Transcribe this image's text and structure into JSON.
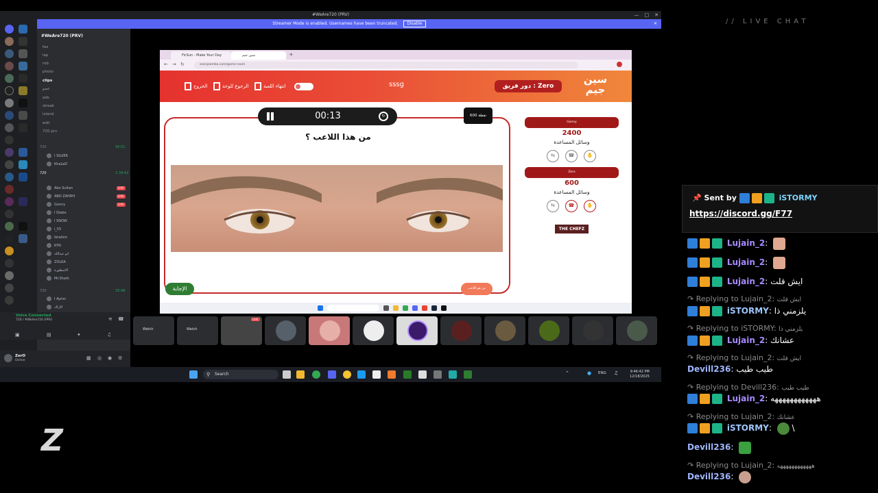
{
  "discord": {
    "window_title": "#WeAre720 (PRV)",
    "streamer_notice": "Streamer Mode is enabled. Usernames have been truncated.",
    "disable_label": "Disable",
    "close_glyph": "✕",
    "server_name": "#WeAre720 (PRV)",
    "channels": [
      "fax",
      "lap",
      "rob",
      "photo",
      "clips",
      "عضو",
      "ads",
      "streak",
      "island",
      "edit",
      "720 prv"
    ],
    "category_1": "720",
    "category_1_time": "56:51",
    "voice_1_users": [
      "I SILVER",
      "KhaLeD"
    ],
    "voice_2_name": "720",
    "voice_2_time": "1:34:42",
    "voice_2_users": [
      "Abo Sultan",
      "ABO ZAHRH",
      "Gonny",
      "I Diabo",
      "I SNOW",
      "i_55",
      "Ibrahim",
      "KYN",
      "ابو عبدالله",
      "ZOLKA",
      "الاسطورة",
      "Mr.Shark"
    ],
    "live_label": "LIVE",
    "category_3": "720",
    "category_3_time": "33:48",
    "voice_3_users": [
      "I Aymn",
      "الاراك"
    ],
    "voice_connected": "Voice Connected",
    "voice_channel": "720 / #WeAre720 (PRV)",
    "user_name": "ZerO",
    "user_tag": "Online"
  },
  "browser": {
    "tab_1": "FicSun - Make Your Day",
    "tab_2": "سين جيم",
    "url": "seenjeemba.com/game-room"
  },
  "game": {
    "center_title": "sssg",
    "turn_label": "دور فريق : Zero",
    "logo_text": "سين جيم",
    "btn_exit": "الخروج",
    "btn_back_board": "الرجوع للوحة",
    "btn_end_game": "انتهاء اللعبة",
    "timer": "00:13",
    "points_tag": "600 نقطة",
    "question": "من هذا اللاعب ؟",
    "answer_btn": "الإجابة",
    "who_btn": "من هو اللاعب",
    "team_1_name": "Gonny",
    "team_1_score": "2400",
    "team_1_help": "وسائل المساعدة",
    "team_2_name": "Zero",
    "team_2_score": "600",
    "team_2_help": "وسائل المساعدة",
    "sponsor": "THE CHEFZ"
  },
  "tiles": {
    "watch_1": "Watch",
    "watch_2": "Watch",
    "live_label": "LIVE"
  },
  "taskbar": {
    "search_placeholder": "Search",
    "lang": "ENG",
    "time": "9:46:42 PM",
    "date": "12/18/2025"
  },
  "chat": {
    "title": "// LIVE CHAT",
    "pin_sent_by": "Sent by",
    "pin_user": "iSTORMY",
    "pin_link": "https://discord.gg/F77",
    "messages": [
      {
        "user": "Lujain_2",
        "text": ""
      },
      {
        "user": "Lujain_2",
        "text": ""
      },
      {
        "user": "Lujain_2",
        "text": "ايش قلت"
      },
      {
        "reply_to": "Lujain_2",
        "quote": "ايش قلت",
        "user": "iSTORMY",
        "text": "يلزمني ذا"
      },
      {
        "reply_to": "iSTORMY",
        "quote": "يلزمني ذا",
        "user": "Lujain_2",
        "text": "عشانك"
      },
      {
        "reply_to": "Lujain_2",
        "quote": "ايش قلت",
        "user": "Devill236",
        "text": "طيب طيب"
      },
      {
        "reply_to": "Devill236",
        "quote": "طيب طيب",
        "user": "Lujain_2",
        "text": "ههههههههههههه"
      },
      {
        "reply_to": "Lujain_2",
        "quote": "عشانك",
        "user": "iSTORMY",
        "text": "\\"
      },
      {
        "user": "Devill236",
        "text": ""
      },
      {
        "reply_to": "Lujain_2",
        "quote": "ههههههههههههه",
        "user": "Devill236",
        "text": ""
      }
    ],
    "replying_prefix": "Replying to"
  },
  "brand": {
    "logo_letter": "Z"
  },
  "colors": {
    "discord_bg": "#313338",
    "blurple": "#5865f2",
    "game_red": "#e5322e",
    "game_orange": "#f0873b",
    "answer_green": "#2e7d32"
  }
}
